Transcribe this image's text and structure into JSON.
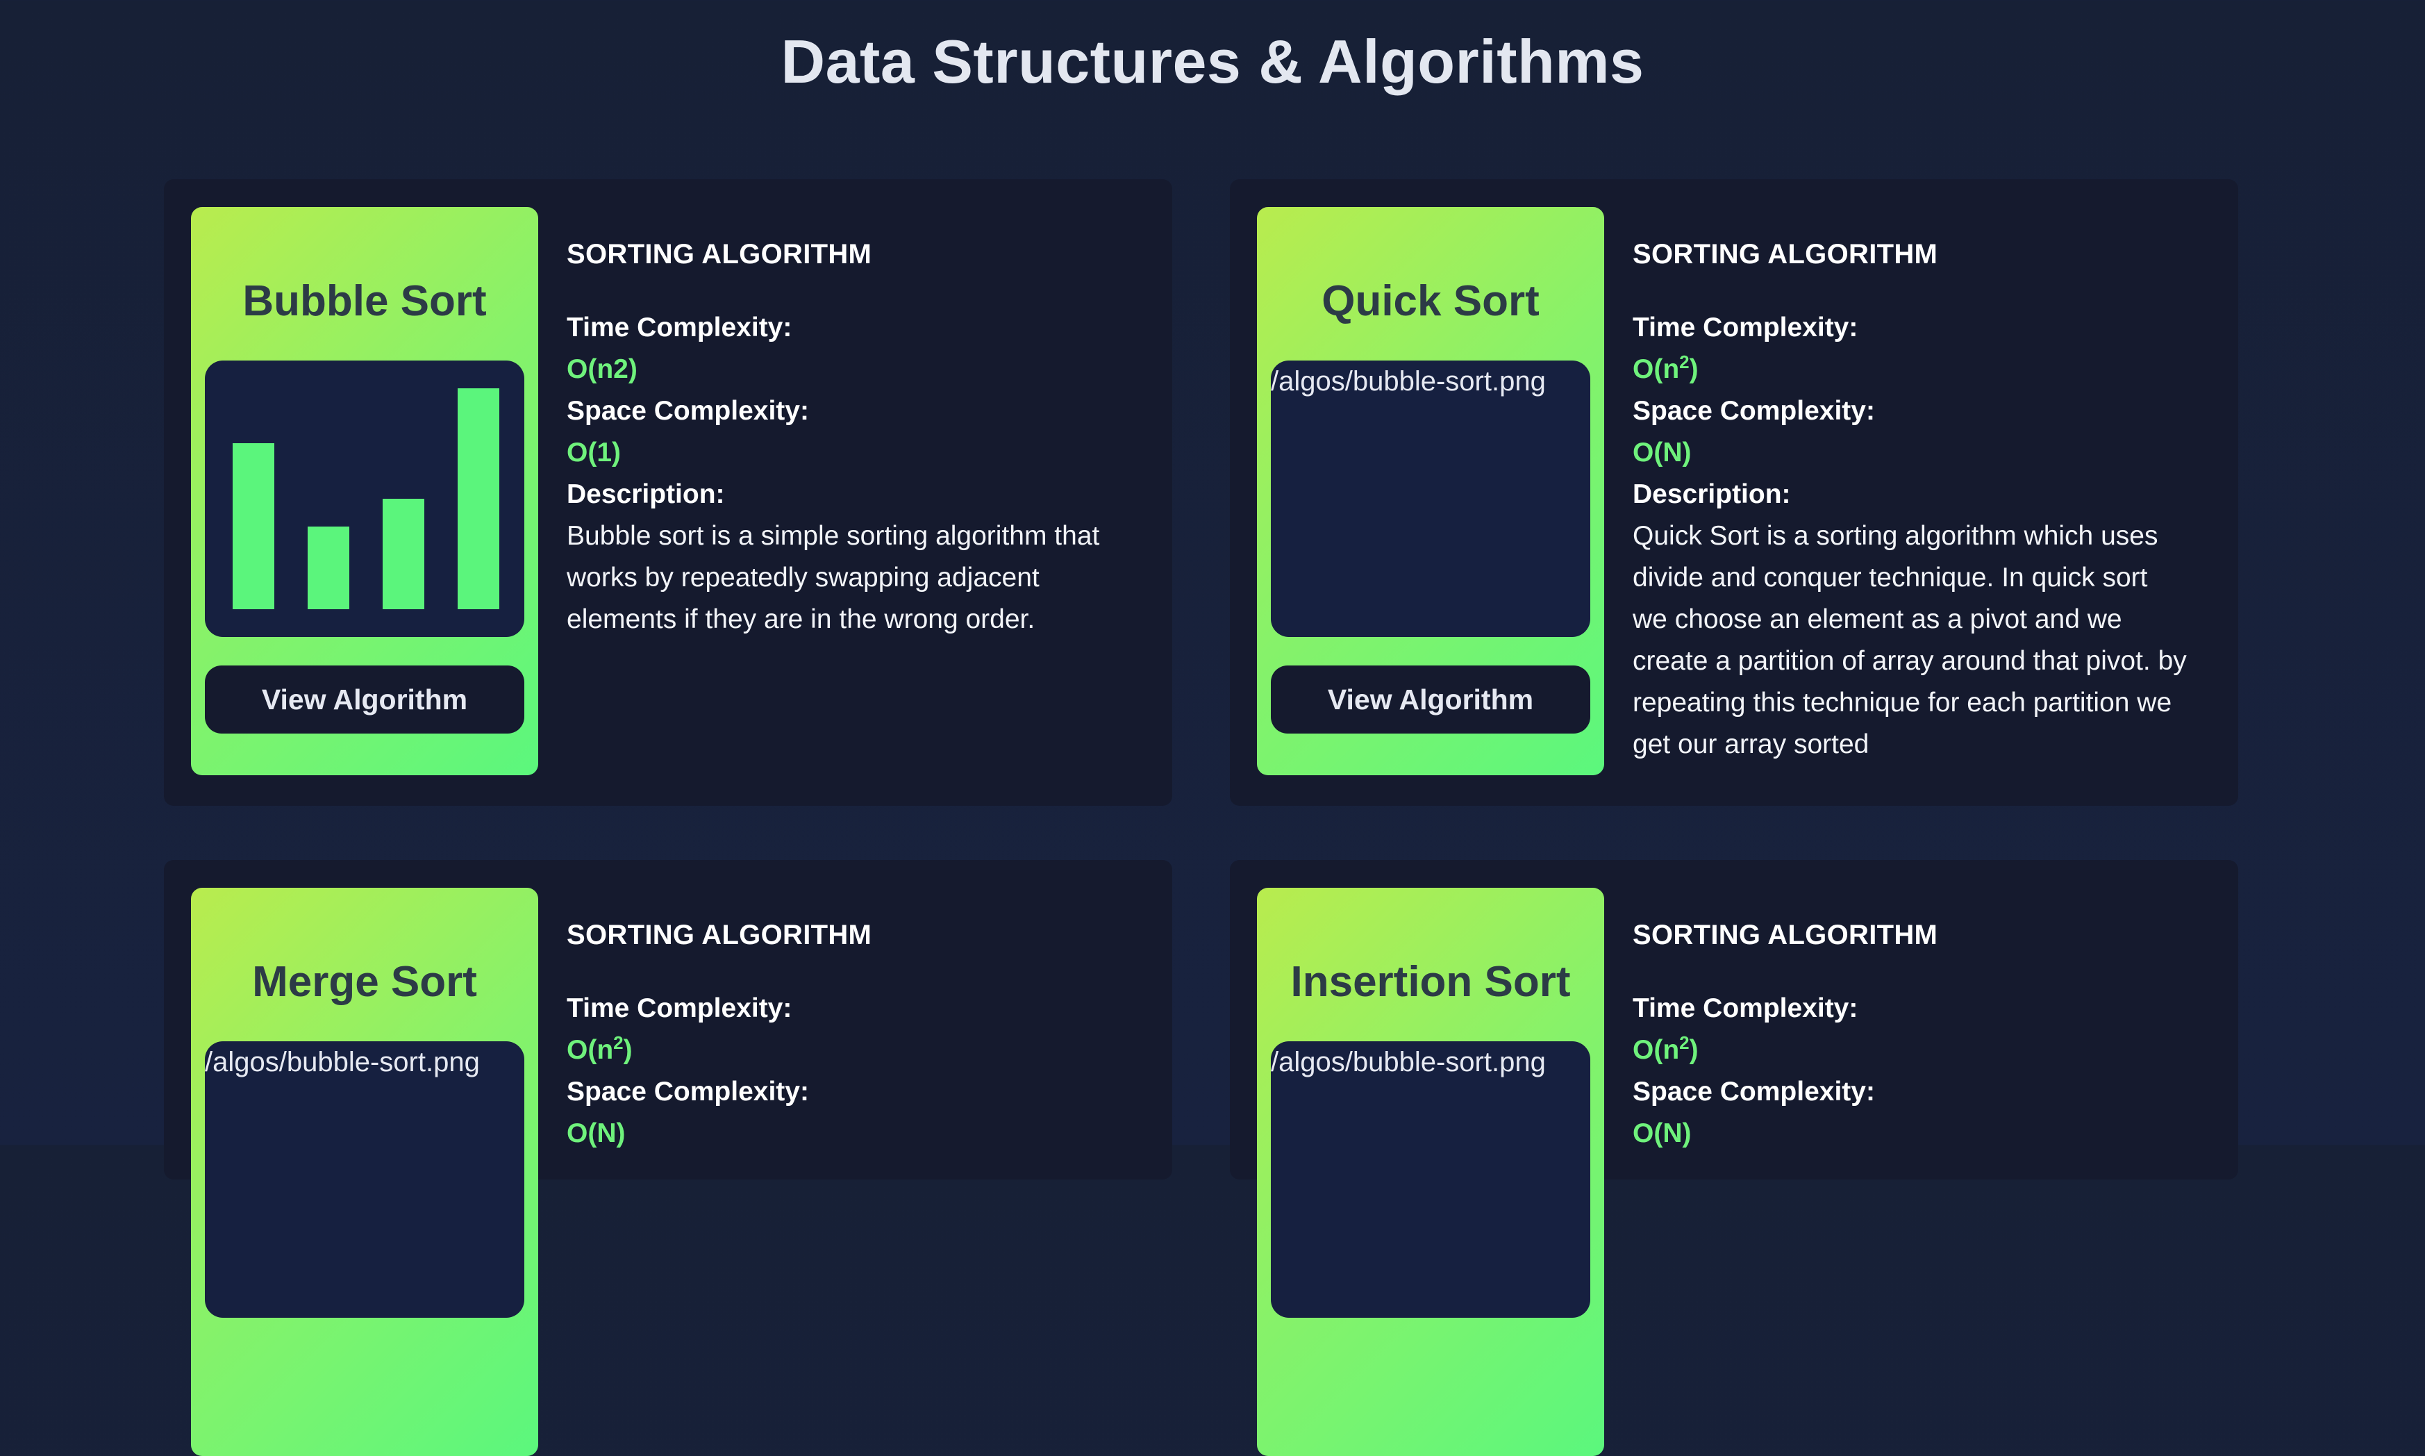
{
  "page_title": "Data Structures & Algorithms",
  "accent_color": "#5bf57c",
  "labels": {
    "time": "Time Complexity:",
    "space": "Space Complexity:",
    "description": "Description:",
    "view_button": "View Algorithm"
  },
  "cards": [
    {
      "name": "Bubble Sort",
      "category": "SORTING ALGORITHM",
      "time_base": "O(n2)",
      "time_exp": "",
      "time_close": "",
      "space": "O(1)",
      "description": "Bubble sort is a simple sorting algorithm that works by repeatedly swapping adjacent elements if they are in the wrong order.",
      "image_alt": "",
      "image_icon": "bar-chart-icon",
      "chart_bars": [
        0.6,
        0.3,
        0.4,
        0.8
      ]
    },
    {
      "name": "Quick Sort",
      "category": "SORTING ALGORITHM",
      "time_base": "O(n",
      "time_exp": "2",
      "time_close": ")",
      "space": "O(N)",
      "description": "Quick Sort is a sorting algorithm which uses divide and conquer technique. In quick sort we choose an element as a pivot and we create a partition of array around that pivot. by repeating this technique for each partition we get our array sorted",
      "image_alt": "/algos/bubble-sort.png"
    },
    {
      "name": "Merge Sort",
      "category": "SORTING ALGORITHM",
      "time_base": "O(n",
      "time_exp": "2",
      "time_close": ")",
      "space": "O(N)",
      "description": "",
      "image_alt": "/algos/bubble-sort.png"
    },
    {
      "name": "Insertion Sort",
      "category": "SORTING ALGORITHM",
      "time_base": "O(n",
      "time_exp": "2",
      "time_close": ")",
      "space": "O(N)",
      "description": "",
      "image_alt": "/algos/bubble-sort.png"
    }
  ]
}
